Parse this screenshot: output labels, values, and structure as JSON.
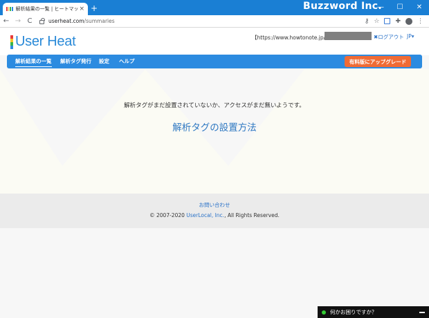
{
  "browser": {
    "tab_title": "解析結果の一覧 | ヒートマップ解析ツ",
    "tab_close": "×",
    "new_tab": "+",
    "watermark": "Buzzword Inc.",
    "window_controls": {
      "minimize": "—",
      "maximize": "☐",
      "close": "✕"
    },
    "url_host": "userheat.com",
    "url_path": "/summaries",
    "nav": {
      "back": "←",
      "forward": "→",
      "reload": "C"
    },
    "toolbar_icons": {
      "key": "⚷",
      "star": "☆",
      "puzzle": "✚",
      "menu": "⋮"
    }
  },
  "header": {
    "logo_text": "User Heat",
    "site_url": "【https://www.howtonote.jp/】",
    "logout": "✖ログアウト",
    "language": "JP▾"
  },
  "navbar": {
    "items": [
      {
        "label": "解析結果の一覧"
      },
      {
        "label": "解析タグ発行"
      },
      {
        "label": "設定"
      },
      {
        "label": "ヘルプ"
      }
    ],
    "upgrade": "有料版にアップグレード"
  },
  "main": {
    "message": "解析タグがまだ設置されていないか、アクセスがまだ無いようです。",
    "setup_link": "解析タグの設置方法"
  },
  "footer": {
    "contact": "お問い合わせ",
    "copyright_prefix": "© 2007-2020 ",
    "company": "UserLocal, Inc.",
    "copyright_suffix": ", All Rights Reserved."
  },
  "chat": {
    "label": "何かお困りですか？"
  },
  "colors": {
    "accent": "#2c8be0",
    "upgrade": "#f06b35",
    "link": "#2f78c2",
    "chrome": "#1a7fd4"
  }
}
